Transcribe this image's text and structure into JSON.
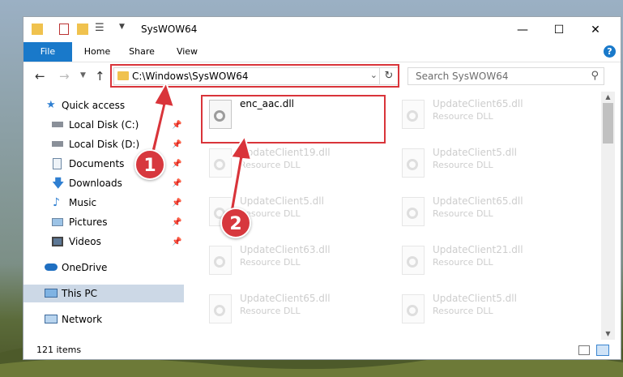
{
  "window": {
    "title": "SysWOW64",
    "controls": {
      "minimize": "—",
      "maximize": "☐",
      "close": "✕"
    }
  },
  "ribbon": {
    "tabs": [
      {
        "label": "File"
      },
      {
        "label": "Home"
      },
      {
        "label": "Share"
      },
      {
        "label": "View"
      }
    ],
    "help_label": "?"
  },
  "nav": {
    "address_path": "C:\\Windows\\SysWOW64",
    "search_placeholder": "Search SysWOW64"
  },
  "sidebar": {
    "items": [
      {
        "label": "Quick access",
        "icon": "star-icon"
      },
      {
        "label": "Local Disk (C:)",
        "icon": "drive-icon",
        "pinned": true
      },
      {
        "label": "Local Disk (D:)",
        "icon": "drive-icon",
        "pinned": true
      },
      {
        "label": "Documents",
        "icon": "documents-icon",
        "pinned": true
      },
      {
        "label": "Downloads",
        "icon": "download-icon",
        "pinned": true
      },
      {
        "label": "Music",
        "icon": "music-icon",
        "pinned": true
      },
      {
        "label": "Pictures",
        "icon": "pictures-icon",
        "pinned": true
      },
      {
        "label": "Videos",
        "icon": "videos-icon",
        "pinned": true
      },
      {
        "label": "OneDrive",
        "icon": "cloud-icon"
      },
      {
        "label": "This PC",
        "icon": "computer-icon",
        "selected": true
      },
      {
        "label": "Network",
        "icon": "network-icon"
      }
    ]
  },
  "files": [
    {
      "name": "enc_aac.dll",
      "desc": ""
    },
    {
      "name": "UpdateClient65.dll",
      "desc": "Resource DLL"
    },
    {
      "name": "UpdateClient19.dll",
      "desc": "Resource DLL"
    },
    {
      "name": "UpdateClient5.dll",
      "desc": "Resource DLL"
    },
    {
      "name": "UpdateClient5.dll",
      "desc": "Resource DLL"
    },
    {
      "name": "UpdateClient65.dll",
      "desc": "Resource DLL"
    },
    {
      "name": "UpdateClient63.dll",
      "desc": "Resource DLL"
    },
    {
      "name": "UpdateClient21.dll",
      "desc": "Resource DLL"
    },
    {
      "name": "UpdateClient65.dll",
      "desc": "Resource DLL"
    },
    {
      "name": "UpdateClient5.dll",
      "desc": "Resource DLL"
    }
  ],
  "status": {
    "item_count": "121 items"
  },
  "annotations": {
    "step1": "1",
    "step2": "2",
    "color": "#d9343a"
  }
}
